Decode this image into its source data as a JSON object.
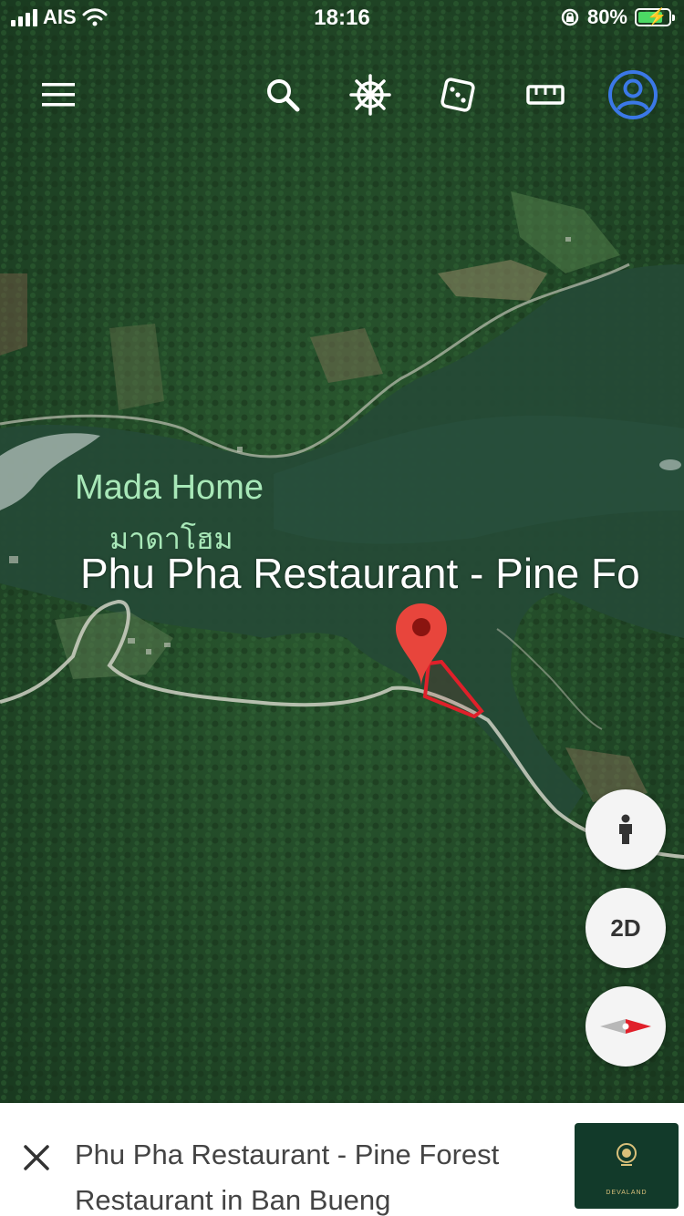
{
  "status_bar": {
    "carrier": "AIS",
    "time": "18:16",
    "battery_percent": "80%",
    "battery_level": 0.8,
    "icons": [
      "cellular-signal-icon",
      "wifi-icon",
      "rotation-lock-icon",
      "battery-charging-icon"
    ]
  },
  "toolbar": {
    "icons": [
      "menu-icon",
      "search-icon",
      "voyager-wheel-icon",
      "dice-icon",
      "ruler-icon",
      "account-icon"
    ]
  },
  "map": {
    "labels": {
      "place_en": "Mada Home",
      "place_th": "มาดาโฮม",
      "selected_place": "Phu Pha Restaurant - Pine Fo"
    },
    "colors": {
      "label_green": "#a8e8b8",
      "pin_red": "#e8453c",
      "parcel_outline": "#e0202a"
    }
  },
  "controls": {
    "pegman_icon": "person-icon",
    "view_mode": "2D",
    "compass_icon": "compass-icon"
  },
  "bottom_sheet": {
    "title": "Phu Pha Restaurant - Pine Forest Restaurant in Ban Bueng",
    "thumbnail_brand": "DEVALAND",
    "close_icon": "close-icon"
  }
}
